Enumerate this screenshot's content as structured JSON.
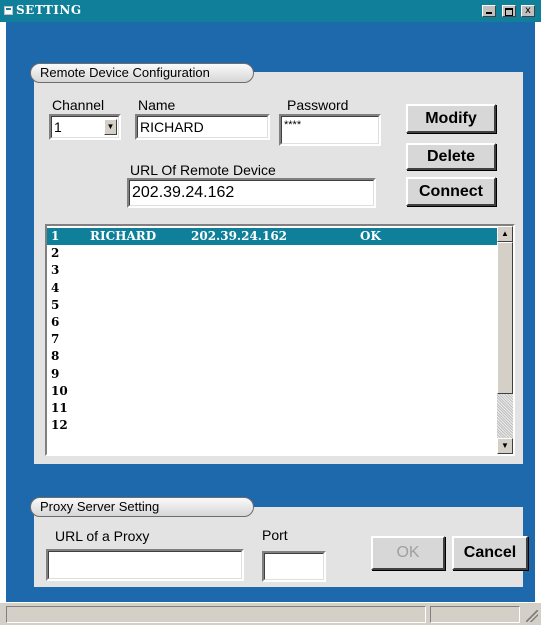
{
  "window": {
    "title": "SETTING",
    "controls": {
      "minimize": "_",
      "maximize": "□",
      "close": "x"
    },
    "accent_color": "#10809a",
    "client_color": "#1e69ac"
  },
  "remote_device": {
    "group_label": "Remote Device Configuration",
    "channel_label": "Channel",
    "channel_value": "1",
    "name_label": "Name",
    "name_value": "RICHARD",
    "password_label": "Password",
    "password_value": "****",
    "url_label": "URL Of Remote Device",
    "url_value": "202.39.24.162",
    "buttons": {
      "modify": "Modify",
      "delete": "Delete",
      "connect": "Connect"
    },
    "list": [
      {
        "channel": "1",
        "name": "RICHARD",
        "url": "202.39.24.162",
        "status": "OK",
        "selected": true
      },
      {
        "channel": "2",
        "name": "",
        "url": "",
        "status": "",
        "selected": false
      },
      {
        "channel": "3",
        "name": "",
        "url": "",
        "status": "",
        "selected": false
      },
      {
        "channel": "4",
        "name": "",
        "url": "",
        "status": "",
        "selected": false
      },
      {
        "channel": "5",
        "name": "",
        "url": "",
        "status": "",
        "selected": false
      },
      {
        "channel": "6",
        "name": "",
        "url": "",
        "status": "",
        "selected": false
      },
      {
        "channel": "7",
        "name": "",
        "url": "",
        "status": "",
        "selected": false
      },
      {
        "channel": "8",
        "name": "",
        "url": "",
        "status": "",
        "selected": false
      },
      {
        "channel": "9",
        "name": "",
        "url": "",
        "status": "",
        "selected": false
      },
      {
        "channel": "10",
        "name": "",
        "url": "",
        "status": "",
        "selected": false
      },
      {
        "channel": "11",
        "name": "",
        "url": "",
        "status": "",
        "selected": false
      },
      {
        "channel": "12",
        "name": "",
        "url": "",
        "status": "",
        "selected": false
      }
    ]
  },
  "proxy": {
    "group_label": "Proxy Server Setting",
    "url_label": "URL of a Proxy",
    "url_value": "",
    "port_label": "Port",
    "port_value": "",
    "buttons": {
      "ok": "OK",
      "cancel": "Cancel"
    }
  }
}
